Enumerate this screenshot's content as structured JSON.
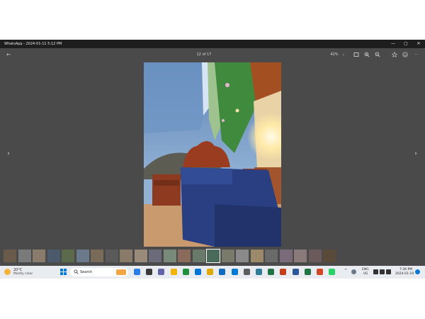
{
  "window": {
    "title": "WhatsApp - 2024-01-11 5:12 PM",
    "minimize_glyph": "—",
    "maximize_glyph": "▢",
    "close_glyph": "✕"
  },
  "toolbar": {
    "back_glyph": "←",
    "counter": "12 of 17",
    "zoom_level": "42%",
    "zoom_chevron": "⌄",
    "more_glyph": "···"
  },
  "viewer": {
    "prev_glyph": "‹",
    "next_glyph": "›"
  },
  "filmstrip": {
    "thumb_count": 23,
    "selected_index": 14,
    "thumb_colors": [
      "#6a5a4a",
      "#7a7a7a",
      "#8a7c6c",
      "#4a5a6a",
      "#5a6a4a",
      "#6a7a8a",
      "#7a6a5a",
      "#5a5a5a",
      "#8a7a6a",
      "#9a8a7a",
      "#6a6a7a",
      "#7a8a7a",
      "#8a6a5a",
      "#6a7a6a",
      "#4a6a5a",
      "#7a7a6a",
      "#8a8a8a",
      "#9a8a6a",
      "#6a6a6a",
      "#7a6a7a",
      "#8a7a7a",
      "#6a5a5a",
      "#5a4a3a"
    ]
  },
  "taskbar": {
    "weather_temp": "20°C",
    "weather_desc": "Mostly clear",
    "search_label": "Search",
    "lang_line1": "ENG",
    "lang_line2": "US",
    "time": "7:36 PM",
    "date": "2024-01-19",
    "tray_chevron": "^",
    "app_icon_colors": [
      "#2b7de9",
      "#3a3a3a",
      "#6264a7",
      "#f2b200",
      "#1f8f3c",
      "#0078d4",
      "#e0a800",
      "#0f6cbd",
      "#0078d4",
      "#5d5d5d",
      "#2d7d9a",
      "#217346",
      "#c43e1c",
      "#2b579a",
      "#217346",
      "#d24726",
      "#25d366"
    ]
  },
  "colors": {
    "app_bg": "#4a4a4a",
    "titlebar_bg": "#1e1e1e",
    "taskbar_bg": "#e9edf2"
  }
}
